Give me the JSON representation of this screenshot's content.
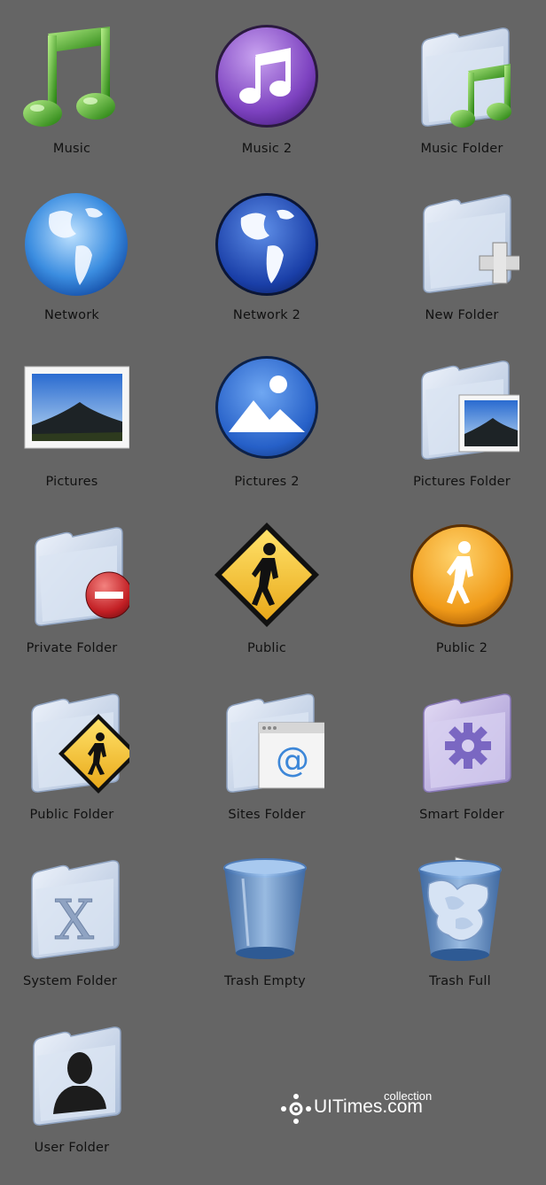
{
  "icons": [
    {
      "label": "Music",
      "icon": "music-note-icon"
    },
    {
      "label": "Music 2",
      "icon": "music-note-circle-icon"
    },
    {
      "label": "Music Folder",
      "icon": "music-folder-icon"
    },
    {
      "label": "Network",
      "icon": "globe-icon"
    },
    {
      "label": "Network 2",
      "icon": "globe-dark-icon"
    },
    {
      "label": "New Folder",
      "icon": "new-folder-icon"
    },
    {
      "label": "Pictures",
      "icon": "picture-icon"
    },
    {
      "label": "Pictures 2",
      "icon": "picture-circle-icon"
    },
    {
      "label": "Pictures Folder",
      "icon": "pictures-folder-icon"
    },
    {
      "label": "Private Folder",
      "icon": "private-folder-icon"
    },
    {
      "label": "Public",
      "icon": "public-sign-icon"
    },
    {
      "label": "Public 2",
      "icon": "public-circle-icon"
    },
    {
      "label": "Public Folder",
      "icon": "public-folder-icon"
    },
    {
      "label": "Sites Folder",
      "icon": "sites-folder-icon"
    },
    {
      "label": "Smart Folder",
      "icon": "smart-folder-icon"
    },
    {
      "label": "System Folder",
      "icon": "system-folder-icon"
    },
    {
      "label": "Trash Empty",
      "icon": "trash-empty-icon"
    },
    {
      "label": "Trash Full",
      "icon": "trash-full-icon"
    },
    {
      "label": "User Folder",
      "icon": "user-folder-icon"
    }
  ],
  "watermark": {
    "text": "UITimes.com",
    "superscript": "collection"
  },
  "colors": {
    "background": "#656565",
    "label": "#111111",
    "folder": "#c9d6ea",
    "green": "#3fa51a",
    "purple": "#8a55c9",
    "blue": "#1f5bc4",
    "orange": "#f0a01e",
    "red": "#c62126"
  }
}
